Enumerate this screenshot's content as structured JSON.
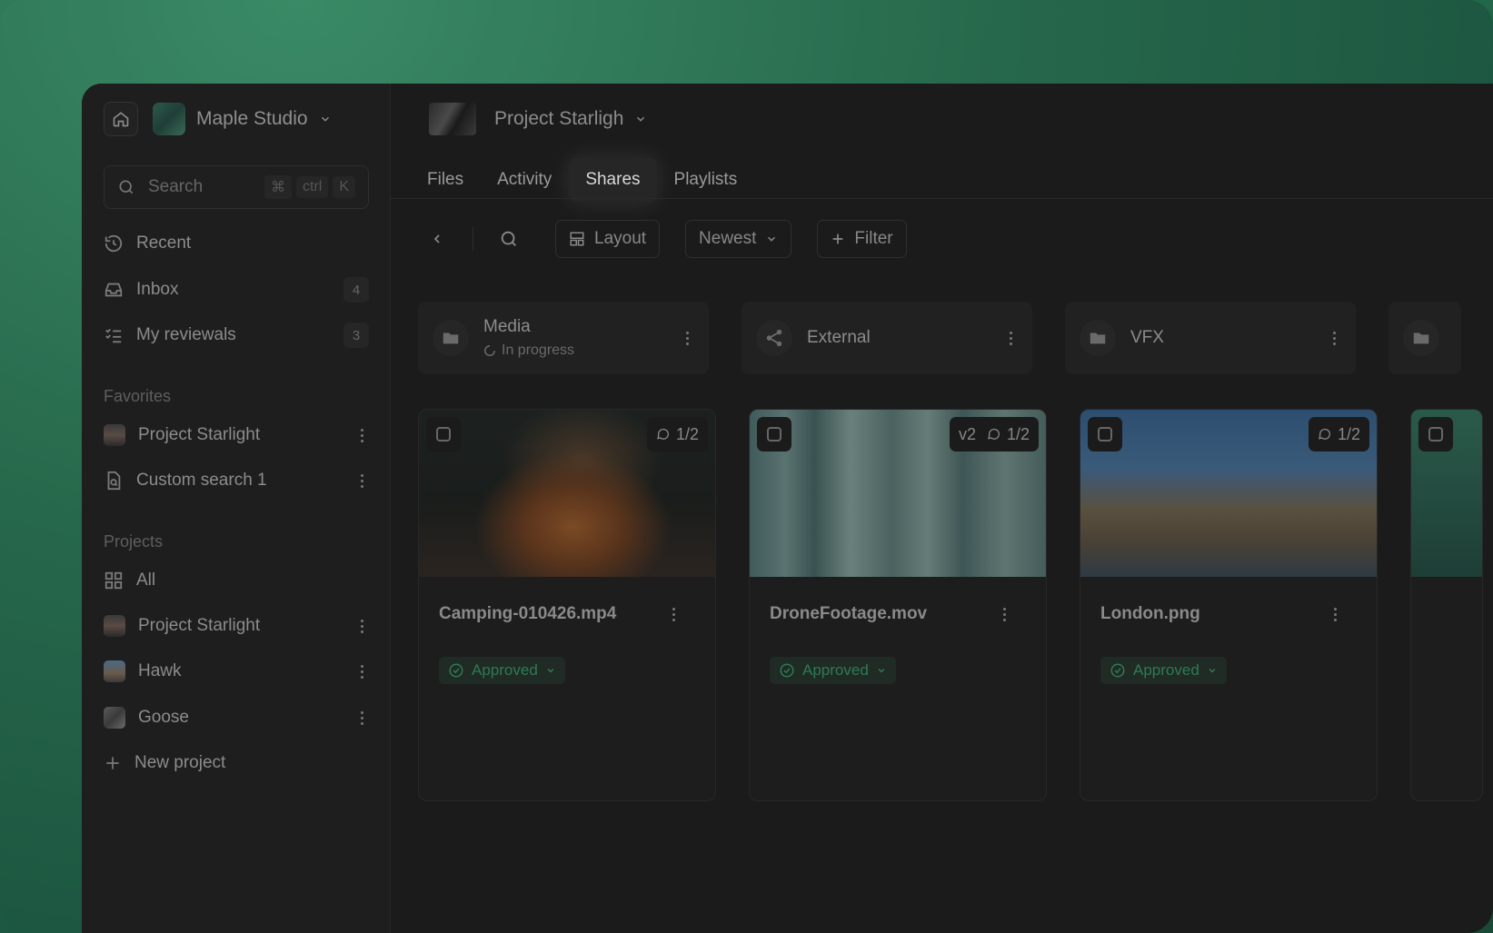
{
  "workspace": {
    "name": "Maple Studio"
  },
  "search": {
    "placeholder": "Search",
    "keys": [
      "⌘",
      "ctrl",
      "K"
    ]
  },
  "nav": [
    {
      "label": "Recent",
      "icon": "history-icon"
    },
    {
      "label": "Inbox",
      "icon": "inbox-icon",
      "badge": "4"
    },
    {
      "label": "My reviewals",
      "icon": "checklist-icon",
      "badge": "3"
    }
  ],
  "favorites": {
    "title": "Favorites",
    "items": [
      {
        "label": "Project Starlight"
      },
      {
        "label": "Custom search 1"
      }
    ]
  },
  "projects": {
    "title": "Projects",
    "all_label": "All",
    "items": [
      {
        "label": "Project Starlight"
      },
      {
        "label": "Hawk"
      },
      {
        "label": "Goose"
      }
    ],
    "new_label": "New project"
  },
  "header": {
    "project_title": "Project Starligh"
  },
  "tabs": [
    {
      "label": "Files"
    },
    {
      "label": "Activity"
    },
    {
      "label": "Shares",
      "active": true
    },
    {
      "label": "Playlists"
    }
  ],
  "toolbar": {
    "layout_label": "Layout",
    "sort_label": "Newest",
    "filter_label": "Filter"
  },
  "folders": [
    {
      "name": "Media",
      "status": "In progress",
      "icon": "folder-icon"
    },
    {
      "name": "External",
      "icon": "share-icon"
    },
    {
      "name": "VFX",
      "icon": "folder-icon"
    }
  ],
  "cards": [
    {
      "name": "Camping-010426.mp4",
      "comments": "1/2",
      "status": "Approved"
    },
    {
      "name": "DroneFootage.mov",
      "version": "v2",
      "comments": "1/2",
      "status": "Approved"
    },
    {
      "name": "London.png",
      "comments": "1/2",
      "status": "Approved"
    }
  ],
  "colors": {
    "accent_green": "#2f7a55",
    "background": "#1b1b1b"
  }
}
